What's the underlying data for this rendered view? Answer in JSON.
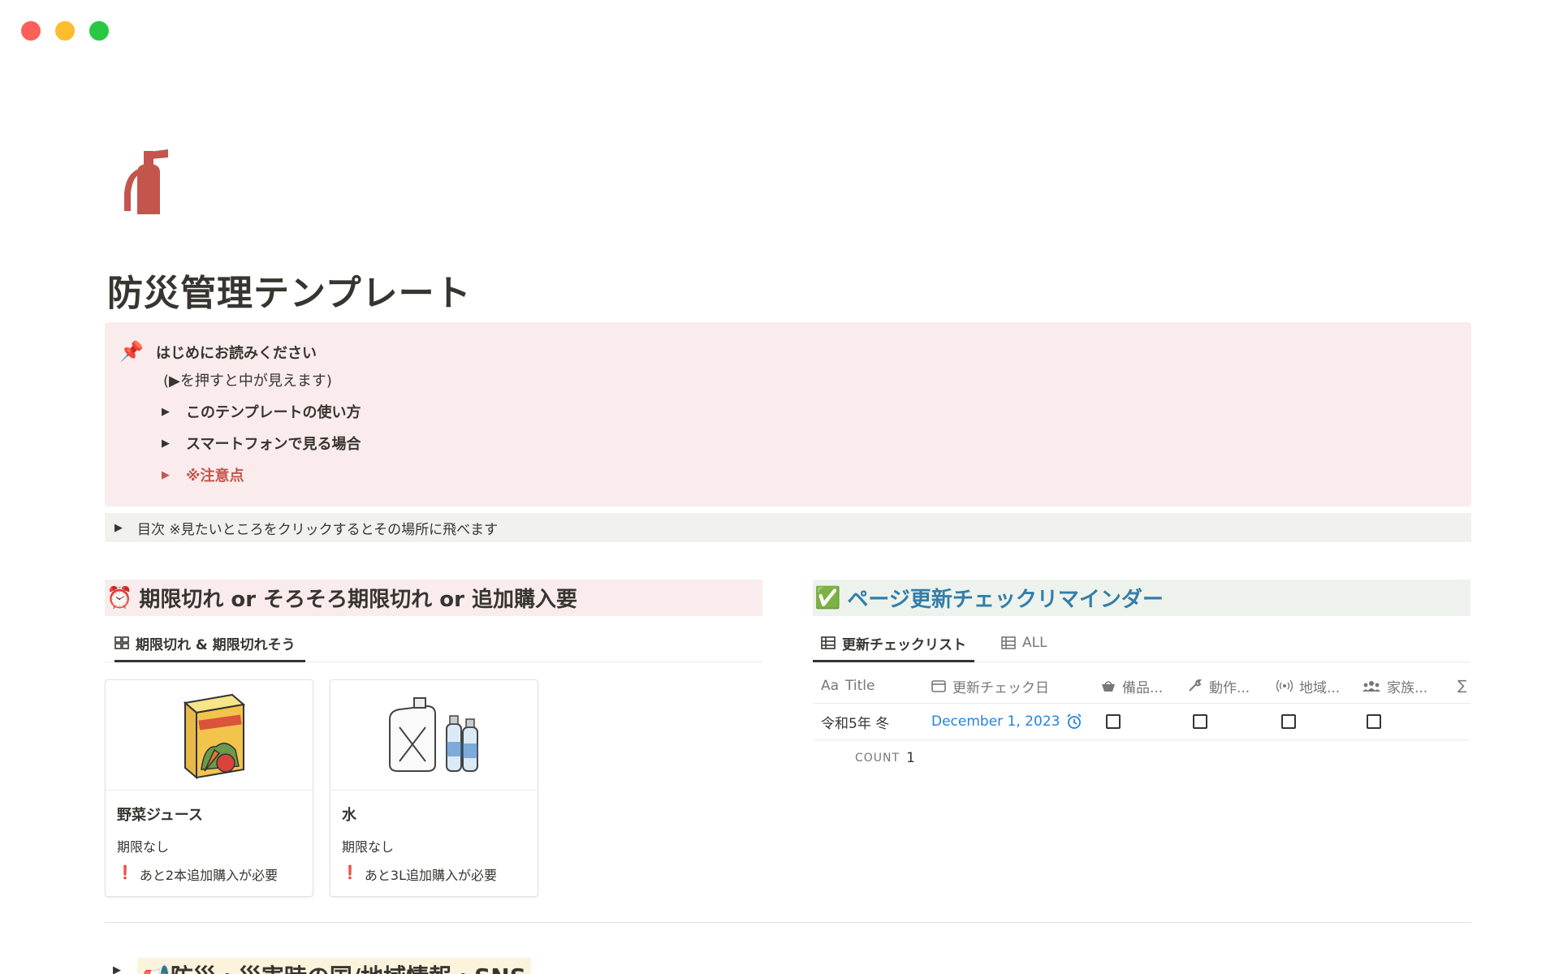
{
  "page": {
    "icon": "fire-extinguisher-icon",
    "title": "防災管理テンプレート"
  },
  "callout": {
    "icon": "pushpin-icon",
    "heading": "はじめにお読みください",
    "subtext": "(▶︎を押すと中が見えます)",
    "toggles": [
      {
        "label": "このテンプレートの使い方",
        "color": "#37352f"
      },
      {
        "label": "スマートフォンで見る場合",
        "color": "#37352f"
      },
      {
        "label": "※注意点",
        "color": "#c4554d"
      }
    ]
  },
  "toc": {
    "label": "目次 ※見たいところをクリックするとその場所に飛べます"
  },
  "expiry_section": {
    "emoji": "⏰",
    "heading": "期限切れ or そろそろ期限切れ or 追加購入要",
    "tab_label": "期限切れ & 期限切れそう",
    "cards": [
      {
        "name": "野菜ジュース",
        "expiry": "期限なし",
        "note_mark": "❗",
        "note": "あと2本追加購入が必要",
        "image": "vegetable-juice-icon"
      },
      {
        "name": "水",
        "expiry": "期限なし",
        "note_mark": "❗",
        "note": "あと3L追加購入が必要",
        "image": "water-bottles-icon"
      }
    ]
  },
  "reminder_section": {
    "emoji": "✅",
    "heading": "ページ更新チェックリマインダー",
    "tabs": [
      {
        "label": "更新チェックリスト",
        "active": true
      },
      {
        "label": "ALL",
        "active": false
      }
    ],
    "columns": {
      "title_prefix": "Aa",
      "title": "Title",
      "date": "更新チェック日",
      "c1": "備品...",
      "c2": "動作...",
      "c3": "地域...",
      "c4": "家族...",
      "more": "∑"
    },
    "rows": [
      {
        "title": "令和5年 冬",
        "date": "December 1, 2023",
        "c1": false,
        "c2": false,
        "c3": false,
        "c4": false
      }
    ],
    "count_label": "COUNT",
    "count_value": "1"
  },
  "bottom": {
    "partial_heading": "📢防災・災害時の国/地域情報・SNS"
  },
  "colors": {
    "callout_bg": "#faecec",
    "green_bg": "#edf3ec",
    "blue_text": "#337ea9",
    "red_text": "#c4554d",
    "link_blue": "#2383e2"
  }
}
